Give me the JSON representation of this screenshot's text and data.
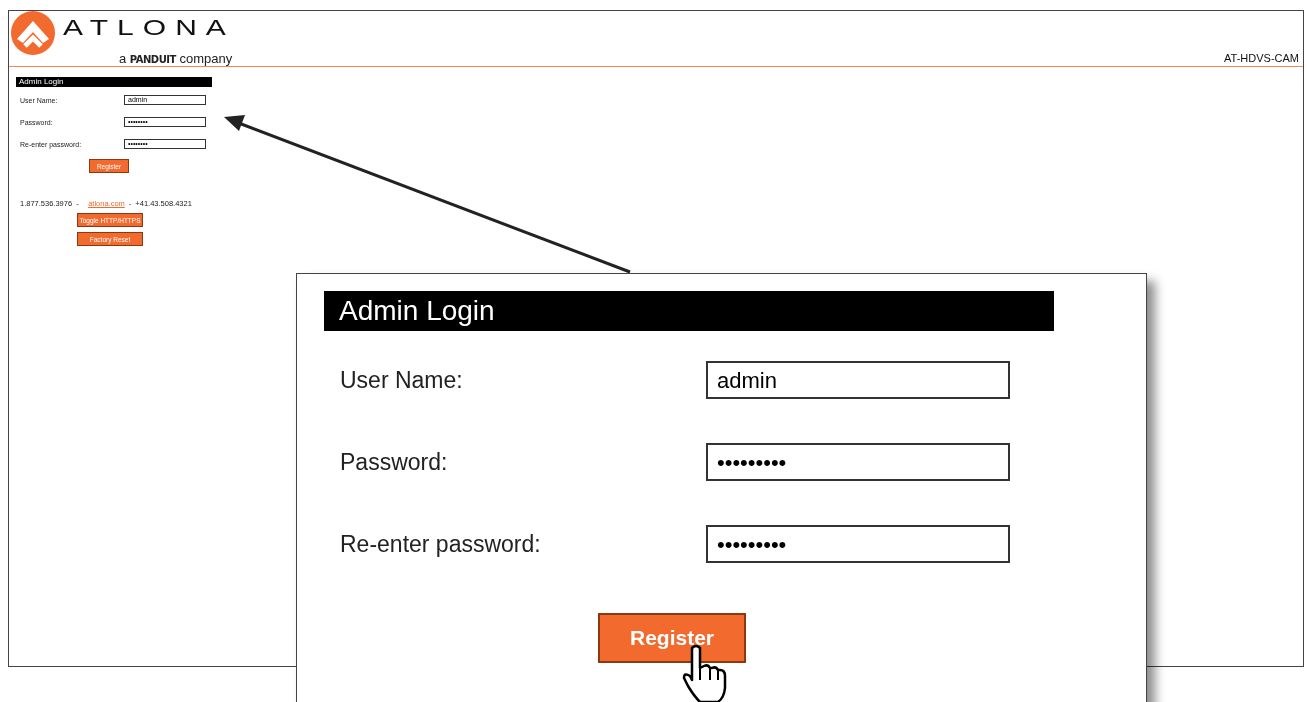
{
  "header": {
    "logo_text": "ATLONA",
    "tagline_prefix": "a",
    "tagline_brand": "PANDUIT",
    "tagline_suffix": "company",
    "model": "AT-HDVS-CAM"
  },
  "login": {
    "title": "Admin Login",
    "fields": [
      {
        "label": "User Name:",
        "value": "admin"
      },
      {
        "label": "Password:",
        "value": "••••••••"
      },
      {
        "label": "Re-enter password:",
        "value": "••••••••"
      }
    ],
    "register": "Register"
  },
  "contact": {
    "phone": "1.877.536.3976",
    "separator_1": "-",
    "link": "atlona.com",
    "separator_2": "-",
    "phone_intl": "+41.43.508.4321"
  },
  "buttons": [
    "Toggle HTTP/HTTPS",
    "Factory Reset"
  ],
  "callout": {
    "title": "Admin Login",
    "fields": [
      {
        "label": "User Name:",
        "value": "admin"
      },
      {
        "label": "Password:",
        "value": "•••••••••"
      },
      {
        "label": "Re-enter password:",
        "value": "•••••••••"
      }
    ],
    "register": "Register"
  }
}
